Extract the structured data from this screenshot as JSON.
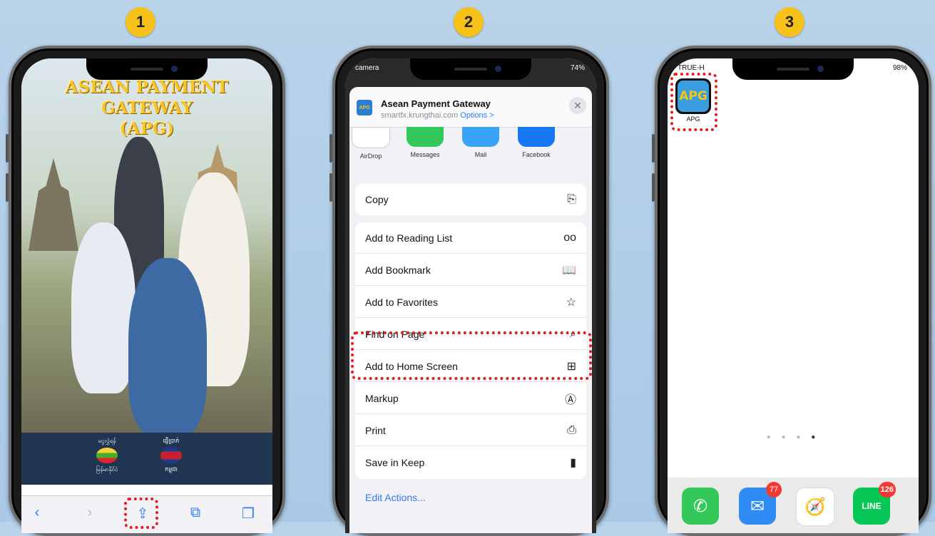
{
  "steps": [
    "1",
    "2",
    "3"
  ],
  "phone1": {
    "title_line1": "ASEAN PAYMENT GATEWAY",
    "title_line2": "(APG)",
    "flags": [
      {
        "top": "ငွေလွှဲရန်",
        "bottom": "မြန်မာနိုင်ငံ",
        "color": "#f7d33b"
      },
      {
        "top": "ផ្ញើប្រាក់",
        "bottom": "កម្ពុជា",
        "color": "#c7202a"
      }
    ],
    "toolbar": {
      "back": "‹",
      "forward": "›",
      "share": "⇪",
      "bookmarks": "⧉",
      "tabs": "❐"
    }
  },
  "phone2": {
    "status_left": "camera",
    "status_right": "74%",
    "header_title": "Asean Payment Gateway",
    "header_sub": "smartfx.krungthai.com",
    "header_options": "Options >",
    "thumb": "APG",
    "apps": [
      "AirDrop",
      "Messages",
      "Mail",
      "Facebook"
    ],
    "copy": {
      "label": "Copy",
      "icon": "⎘"
    },
    "actions": [
      {
        "label": "Add to Reading List",
        "icon": "oo"
      },
      {
        "label": "Add Bookmark",
        "icon": "📖"
      },
      {
        "label": "Add to Favorites",
        "icon": "☆"
      },
      {
        "label": "Find on Page",
        "icon": "⌕"
      },
      {
        "label": "Add to Home Screen",
        "icon": "⊞"
      },
      {
        "label": "Markup",
        "icon": "Ⓐ"
      },
      {
        "label": "Print",
        "icon": "⎙"
      },
      {
        "label": "Save in Keep",
        "icon": "▮"
      }
    ],
    "edit_actions": "Edit Actions..."
  },
  "phone3": {
    "status_left": "TRUE-H",
    "status_right": "98%",
    "app_icon": "APG",
    "app_label": "APG",
    "dock": [
      {
        "name": "phone",
        "badge": ""
      },
      {
        "name": "mail",
        "badge": "77"
      },
      {
        "name": "safari",
        "badge": ""
      },
      {
        "name": "line",
        "badge": "126",
        "text": "LINE"
      }
    ]
  }
}
